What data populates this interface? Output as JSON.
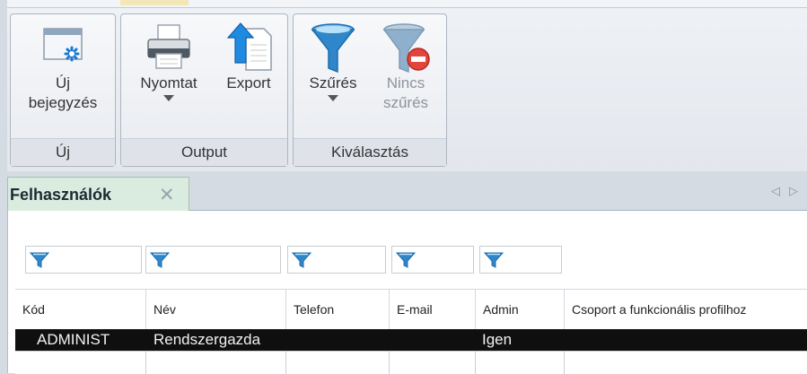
{
  "ribbon": {
    "groups": {
      "uj": {
        "title": "Új",
        "buttons": {
          "new_entry": {
            "label_line1": "Új",
            "label_line2": "bejegyzés",
            "icon": "new-window-icon"
          }
        }
      },
      "output": {
        "title": "Output",
        "buttons": {
          "print": {
            "label": "Nyomtat",
            "icon": "printer-icon",
            "has_dropdown": true
          },
          "export": {
            "label": "Export",
            "icon": "export-icon"
          }
        }
      },
      "kivalasztas": {
        "title": "Kiválasztás",
        "buttons": {
          "filter": {
            "label": "Szűrés",
            "icon": "funnel-icon",
            "has_dropdown": true
          },
          "no_filter": {
            "label_line1": "Nincs",
            "label_line2": "szűrés",
            "icon": "funnel-remove-icon",
            "disabled": true
          }
        }
      }
    }
  },
  "tabs": [
    {
      "label": "Felhasználók",
      "active": true,
      "closable": true
    }
  ],
  "tab_nav": {
    "left": "◁",
    "right": "▷"
  },
  "grid": {
    "columns": [
      "Kód",
      "Név",
      "Telefon",
      "E-mail",
      "Admin",
      "Csoport a funkcionális profilhoz"
    ],
    "filters": [
      "",
      "",
      "",
      "",
      ""
    ],
    "rows": [
      {
        "kod": "ADMINIST",
        "nev": "Rendszergazda",
        "telefon": "",
        "email": "",
        "admin": "Igen",
        "csoport": "",
        "selected": true
      }
    ]
  },
  "colors": {
    "accent_tab": "#d9ecdf",
    "funnel": "#2f86c8",
    "selected_row": "#0f0f0f"
  }
}
